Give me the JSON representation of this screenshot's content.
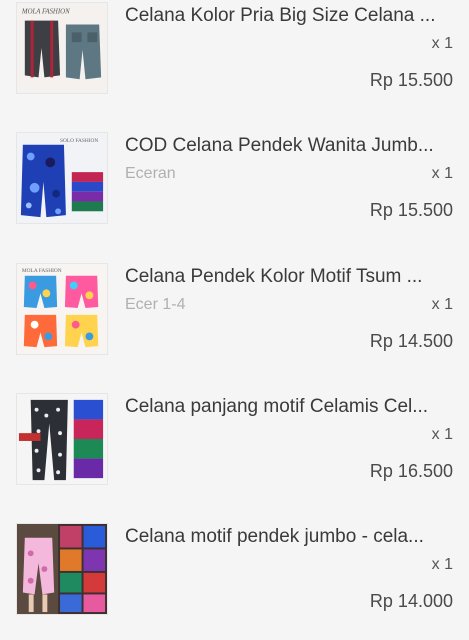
{
  "order_items": [
    {
      "title": "Celana Kolor Pria Big Size Celana ...",
      "variant": "",
      "quantity": "x 1",
      "price": "Rp 15.500",
      "thumb_text": "MOLA FASHION"
    },
    {
      "title": "COD Celana Pendek Wanita Jumb...",
      "variant": "Eceran",
      "quantity": "x 1",
      "price": "Rp 15.500",
      "thumb_text": "SOLO FASHION"
    },
    {
      "title": "Celana Pendek Kolor Motif Tsum ...",
      "variant": "Ecer 1-4",
      "quantity": "x 1",
      "price": "Rp 14.500",
      "thumb_text": "MOLA FASHION"
    },
    {
      "title": "Celana panjang motif Celamis Cel...",
      "variant": "",
      "quantity": "x 1",
      "price": "Rp 16.500",
      "thumb_text": ""
    },
    {
      "title": "Celana motif pendek jumbo - cela...",
      "variant": "",
      "quantity": "x 1",
      "price": "Rp 14.000",
      "thumb_text": ""
    }
  ]
}
